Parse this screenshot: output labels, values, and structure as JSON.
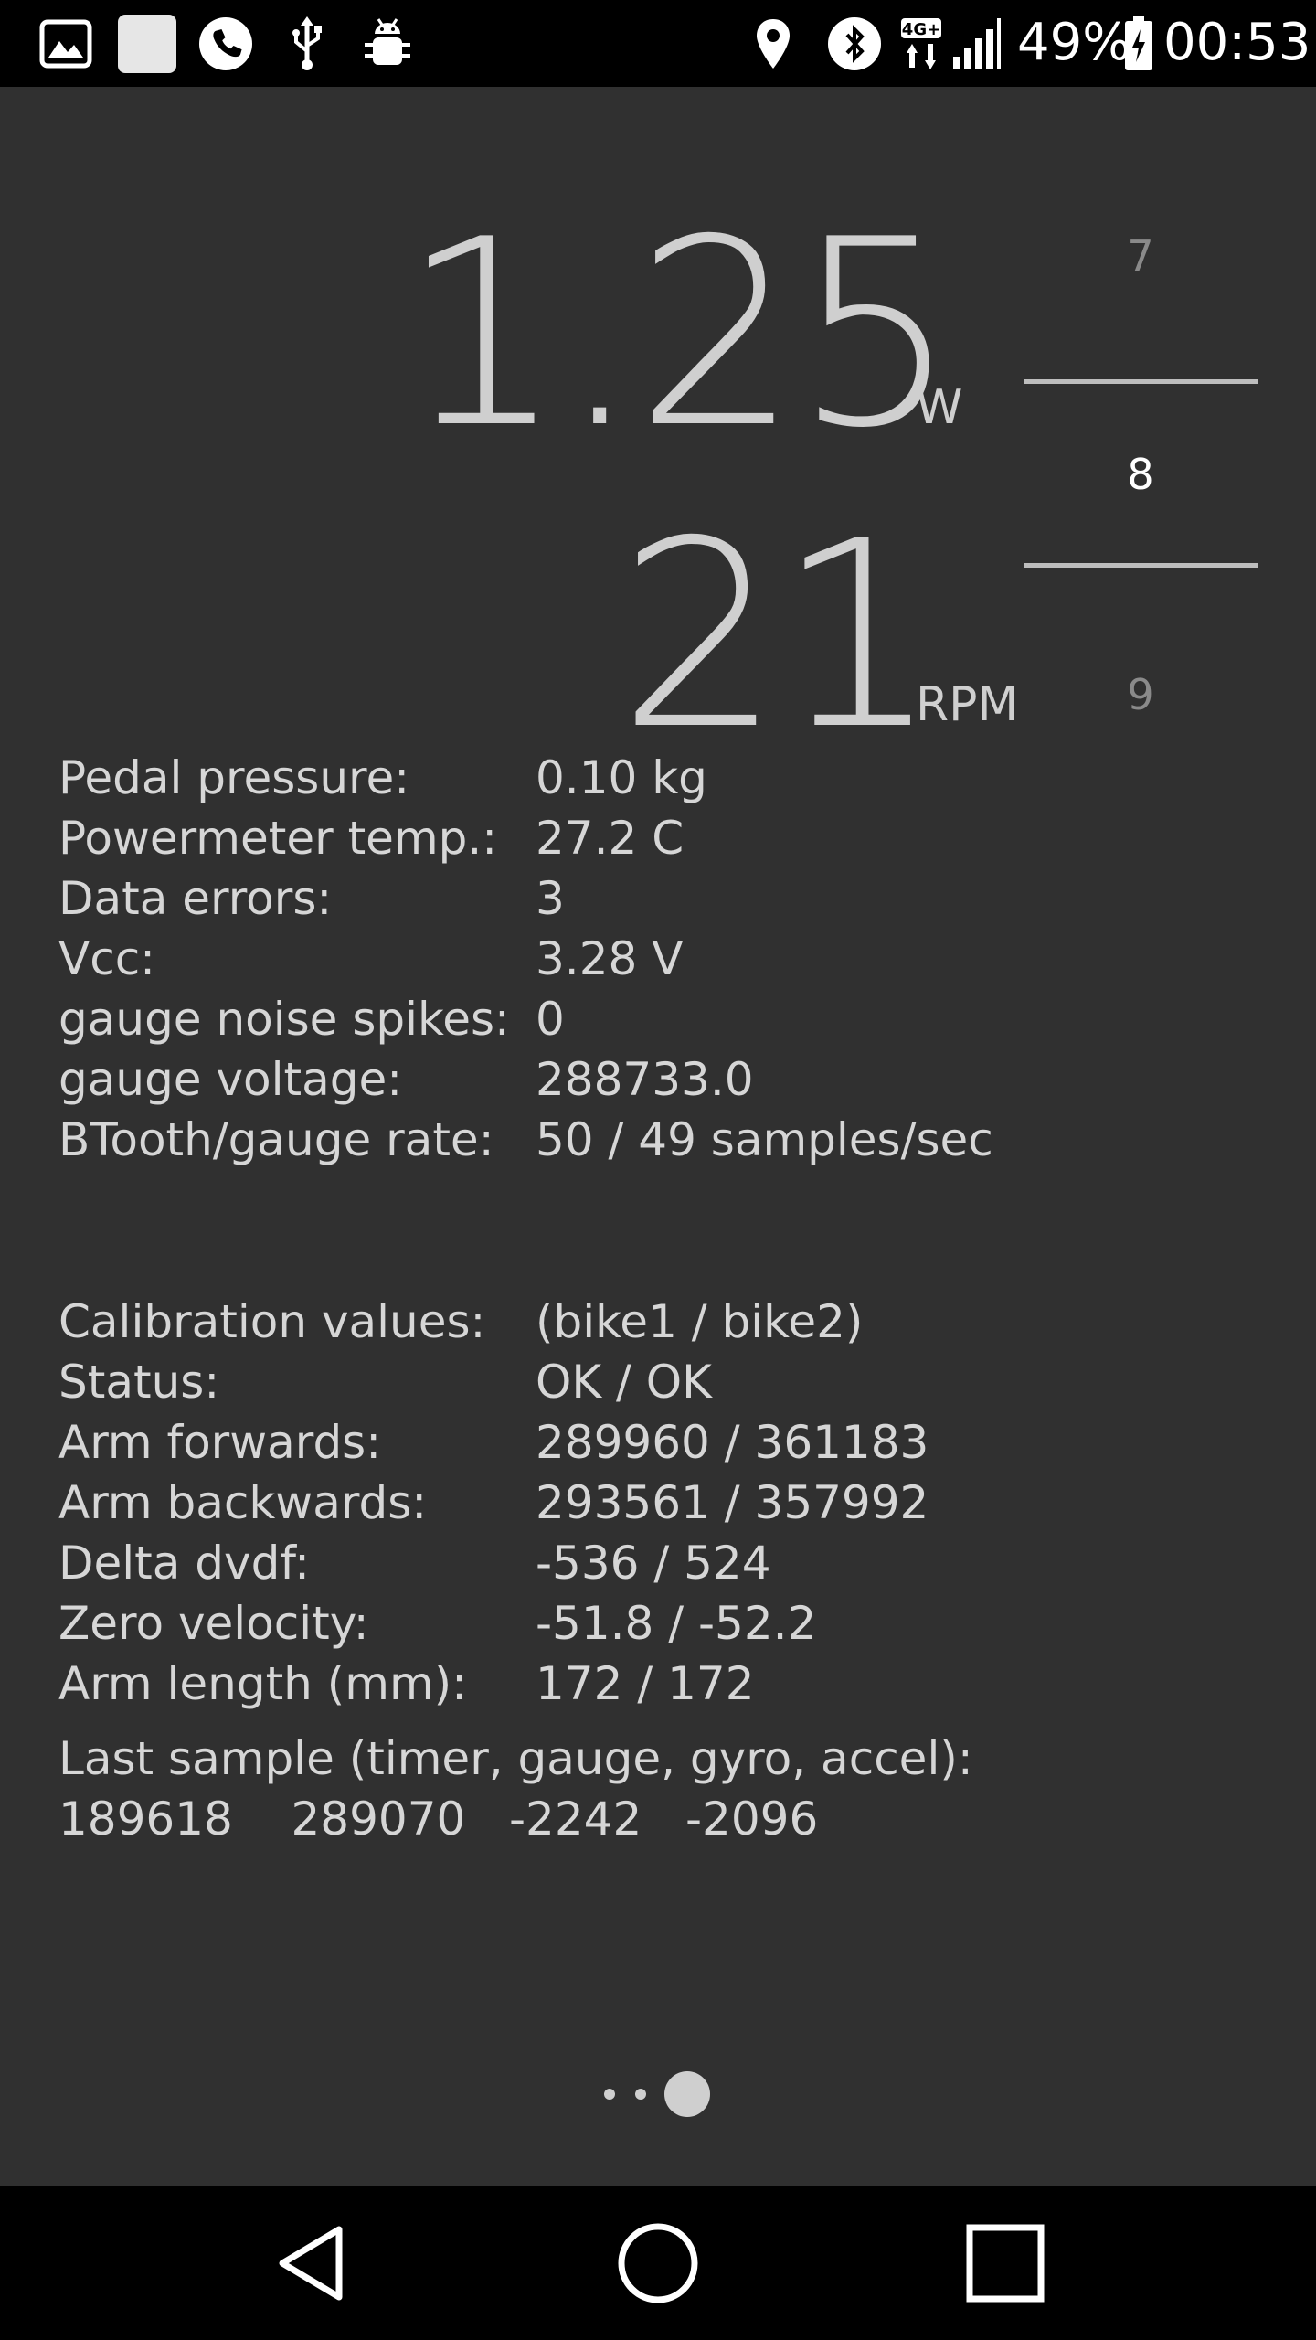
{
  "status_bar": {
    "battery": "49%",
    "time": "00:53",
    "network_badge": "4G+",
    "icons": [
      "gallery-icon",
      "blank-app-icon",
      "phone-icon",
      "usb-icon",
      "android-debug-icon",
      "location-icon",
      "bluetooth-icon",
      "network-4g-icon",
      "signal-icon",
      "battery-icon"
    ]
  },
  "meter": {
    "power_value": "1.25",
    "power_unit": "W",
    "cadence_value": "21",
    "cadence_unit": "RPM"
  },
  "picker": {
    "prev": "7",
    "current": "8",
    "next": "9"
  },
  "stats": [
    {
      "label": "Pedal pressure:",
      "value": "0.10 kg"
    },
    {
      "label": "Powermeter temp.:",
      "value": "27.2 C"
    },
    {
      "label": "Data errors:",
      "value": "3"
    },
    {
      "label": "Vcc:",
      "value": "3.28 V"
    },
    {
      "label": "gauge noise spikes:",
      "value": "0"
    },
    {
      "label": "gauge voltage:",
      "value": "288733.0"
    },
    {
      "label": "BTooth/gauge rate:",
      "value": "50 / 49 samples/sec"
    }
  ],
  "calibration": [
    {
      "label": "Calibration values:",
      "value": "(bike1 / bike2)"
    },
    {
      "label": "Status:",
      "value": "OK / OK"
    },
    {
      "label": "Arm forwards:",
      "value": "289960 / 361183"
    },
    {
      "label": "Arm backwards:",
      "value": "293561 / 357992"
    },
    {
      "label": "Delta dvdf:",
      "value": "-536 / 524"
    },
    {
      "label": "Zero velocity:",
      "value": "-51.8 / -52.2"
    },
    {
      "label": "Arm length (mm):",
      "value": "172 / 172"
    }
  ],
  "last_sample": {
    "heading": "Last sample (timer, gauge, gyro, accel):",
    "values": "189618    289070   -2242   -2096"
  },
  "pager": {
    "total": 3,
    "active_index": 2
  },
  "nav": {
    "icons": [
      "back-icon",
      "home-icon",
      "recents-icon"
    ]
  },
  "colors": {
    "app_background": "#303030",
    "text": "#d6d6d6",
    "picker_dim": "#8a8a8a",
    "picker_active": "#ffffff"
  }
}
